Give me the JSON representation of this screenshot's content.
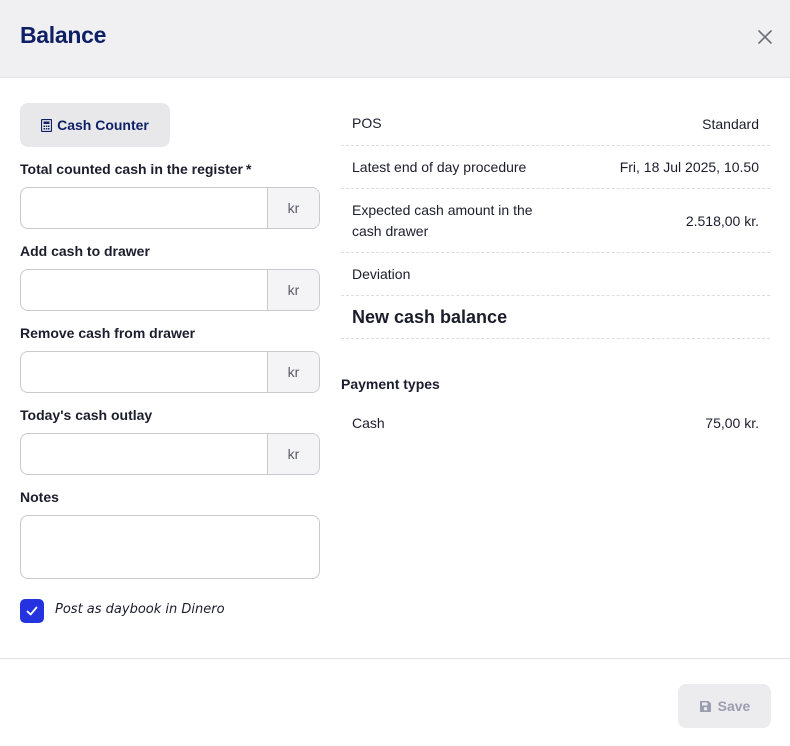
{
  "header": {
    "title": "Balance"
  },
  "left": {
    "cash_counter_label": "Cash Counter",
    "fields": [
      {
        "label": "Total counted cash in the register",
        "required_mark": "*",
        "value": "",
        "suffix": "kr"
      },
      {
        "label": "Add cash to drawer",
        "value": "",
        "suffix": "kr"
      },
      {
        "label": "Remove cash from drawer",
        "value": "",
        "suffix": "kr"
      },
      {
        "label": "Today's cash outlay",
        "value": "",
        "suffix": "kr"
      }
    ],
    "notes_label": "Notes",
    "notes_value": "",
    "checkbox_label": "Post as daybook in Dinero",
    "checkbox_checked": true
  },
  "summary": {
    "rows": [
      {
        "key": "POS",
        "value": "Standard"
      },
      {
        "key": "Latest end of day procedure",
        "value": "Fri, 18 Jul 2025, 10.50"
      },
      {
        "key": "Expected cash amount in the cash drawer",
        "value": "2.518,00 kr."
      },
      {
        "key": "Deviation",
        "value": ""
      }
    ],
    "new_balance_label": "New cash balance",
    "payment_types_title": "Payment types",
    "payment_types": [
      {
        "key": "Cash",
        "value": "75,00 kr."
      }
    ]
  },
  "footer": {
    "save_label": "Save"
  },
  "colors": {
    "accent": "#2432e0",
    "title": "#0f1f66",
    "header_bg": "#f0f0f2"
  }
}
